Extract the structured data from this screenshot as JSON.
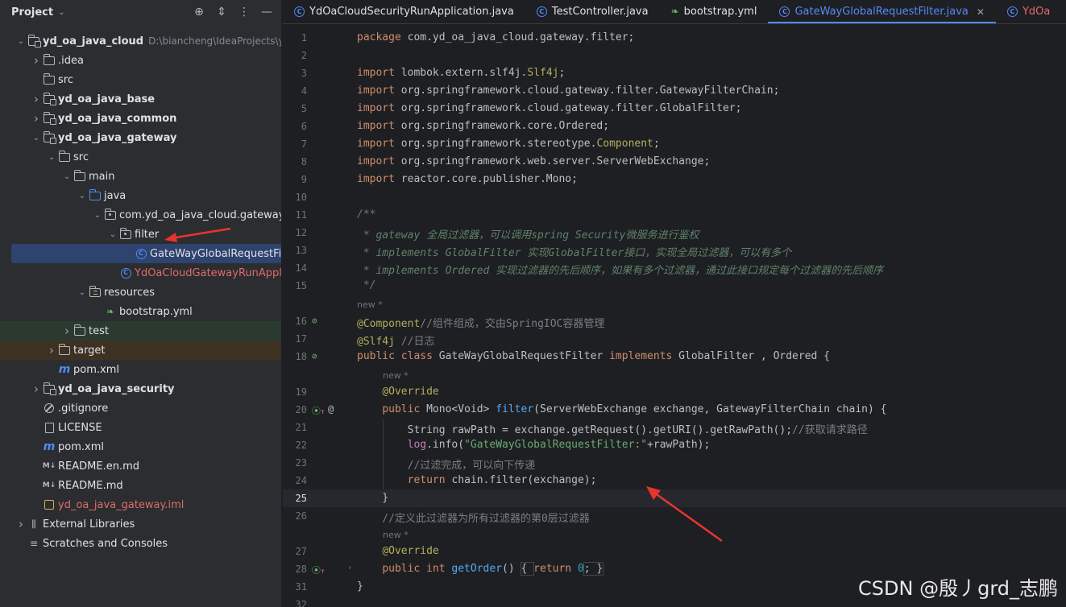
{
  "project_panel": {
    "title": "Project",
    "tree": [
      {
        "label": "yd_oa_java_cloud",
        "path": "D:\\biancheng\\IdeaProjects\\yd",
        "indent": 0,
        "arrow": "down",
        "icon": "module-folder",
        "bold": true
      },
      {
        "label": ".idea",
        "indent": 1,
        "arrow": "right",
        "icon": "folder"
      },
      {
        "label": "src",
        "indent": 1,
        "arrow": "",
        "icon": "folder"
      },
      {
        "label": "yd_oa_java_base",
        "indent": 1,
        "arrow": "right",
        "icon": "module-folder",
        "bold": true
      },
      {
        "label": "yd_oa_java_common",
        "indent": 1,
        "arrow": "right",
        "icon": "module-folder",
        "bold": true
      },
      {
        "label": "yd_oa_java_gateway",
        "indent": 1,
        "arrow": "down",
        "icon": "module-folder",
        "bold": true
      },
      {
        "label": "src",
        "indent": 2,
        "arrow": "down",
        "icon": "folder"
      },
      {
        "label": "main",
        "indent": 3,
        "arrow": "down",
        "icon": "folder"
      },
      {
        "label": "java",
        "indent": 4,
        "arrow": "down",
        "icon": "blue-folder"
      },
      {
        "label": "com.yd_oa_java_cloud.gateway",
        "indent": 5,
        "arrow": "down",
        "icon": "package-folder"
      },
      {
        "label": "filter",
        "indent": 6,
        "arrow": "down",
        "icon": "package-folder"
      },
      {
        "label": "GateWayGlobalRequestFilter",
        "indent": 7,
        "arrow": "",
        "icon": "class",
        "selected": true
      },
      {
        "label": "YdOaCloudGatewayRunApplication",
        "indent": 6,
        "arrow": "",
        "icon": "class",
        "red": true
      },
      {
        "label": "resources",
        "indent": 4,
        "arrow": "down",
        "icon": "resources-folder"
      },
      {
        "label": "bootstrap.yml",
        "indent": 5,
        "arrow": "",
        "icon": "leaf"
      },
      {
        "label": "test",
        "indent": 3,
        "arrow": "right",
        "icon": "folder",
        "bg": "green"
      },
      {
        "label": "target",
        "indent": 2,
        "arrow": "right",
        "icon": "folder",
        "bg": "orange"
      },
      {
        "label": "pom.xml",
        "indent": 2,
        "arrow": "",
        "icon": "maven"
      },
      {
        "label": "yd_oa_java_security",
        "indent": 1,
        "arrow": "right",
        "icon": "module-folder",
        "bold": true
      },
      {
        "label": ".gitignore",
        "indent": 1,
        "arrow": "",
        "icon": "ignore"
      },
      {
        "label": "LICENSE",
        "indent": 1,
        "arrow": "",
        "icon": "file"
      },
      {
        "label": "pom.xml",
        "indent": 1,
        "arrow": "",
        "icon": "maven"
      },
      {
        "label": "README.en.md",
        "indent": 1,
        "arrow": "",
        "icon": "markdown"
      },
      {
        "label": "README.md",
        "indent": 1,
        "arrow": "",
        "icon": "markdown"
      },
      {
        "label": "yd_oa_java_gateway.iml",
        "indent": 1,
        "arrow": "",
        "icon": "iml",
        "red": true
      },
      {
        "label": "External Libraries",
        "indent": 0,
        "arrow": "right",
        "icon": "library"
      },
      {
        "label": "Scratches and Consoles",
        "indent": 0,
        "arrow": "",
        "icon": "scratches"
      }
    ]
  },
  "tabs": [
    {
      "label": "YdOaCloudSecurityRunApplication.java",
      "icon": "class",
      "active": false
    },
    {
      "label": "TestController.java",
      "icon": "class",
      "active": false
    },
    {
      "label": "bootstrap.yml",
      "icon": "leaf",
      "active": false
    },
    {
      "label": "GateWayGlobalRequestFilter.java",
      "icon": "class",
      "active": true,
      "close": "✕"
    },
    {
      "label": "YdOa",
      "icon": "class",
      "active": false,
      "red": true
    }
  ],
  "editor": {
    "lines": [
      {
        "n": "1",
        "seg": [
          [
            "kw",
            "package "
          ],
          [
            "",
            "com.yd_oa_java_cloud.gateway.filter;"
          ]
        ]
      },
      {
        "n": "2",
        "seg": []
      },
      {
        "n": "3",
        "seg": [
          [
            "kw",
            "import "
          ],
          [
            "",
            "lombok.extern.slf4j."
          ],
          [
            "ann",
            "Slf4j"
          ],
          [
            "",
            ";"
          ]
        ]
      },
      {
        "n": "4",
        "seg": [
          [
            "kw",
            "import "
          ],
          [
            "",
            "org.springframework.cloud.gateway.filter.GatewayFilterChain;"
          ]
        ]
      },
      {
        "n": "5",
        "seg": [
          [
            "kw",
            "import "
          ],
          [
            "",
            "org.springframework.cloud.gateway.filter.GlobalFilter;"
          ]
        ]
      },
      {
        "n": "6",
        "seg": [
          [
            "kw",
            "import "
          ],
          [
            "",
            "org.springframework.core.Ordered;"
          ]
        ]
      },
      {
        "n": "7",
        "seg": [
          [
            "kw",
            "import "
          ],
          [
            "",
            "org.springframework.stereotype."
          ],
          [
            "ann",
            "Component"
          ],
          [
            "",
            ";"
          ]
        ]
      },
      {
        "n": "8",
        "seg": [
          [
            "kw",
            "import "
          ],
          [
            "",
            "org.springframework.web.server.ServerWebExchange;"
          ]
        ]
      },
      {
        "n": "9",
        "seg": [
          [
            "kw",
            "import "
          ],
          [
            "",
            "reactor.core.publisher.Mono;"
          ]
        ]
      },
      {
        "n": "10",
        "seg": []
      },
      {
        "n": "11",
        "seg": [
          [
            "doc",
            "/**"
          ]
        ]
      },
      {
        "n": "12",
        "seg": [
          [
            "doc",
            " * gateway 全局过滤器，可以调用spring Security微服务进行鉴权"
          ]
        ]
      },
      {
        "n": "13",
        "seg": [
          [
            "doc",
            " * implements GlobalFilter 实现GlobalFilter接口，实现全局过滤器，可以有多个"
          ]
        ]
      },
      {
        "n": "14",
        "seg": [
          [
            "doc",
            " * implements Ordered 实现过滤器的先后顺序，如果有多个过滤器，通过此接口规定每个过滤器的先后顺序"
          ]
        ]
      },
      {
        "n": "15",
        "seg": [
          [
            "doc",
            " */"
          ]
        ]
      },
      {
        "hint": "new *",
        "indent": 0
      },
      {
        "n": "16",
        "gutter": "bean",
        "seg": [
          [
            "ann",
            "@Component"
          ],
          [
            "cmt",
            "//组件组成，交由SpringIOC容器管理"
          ]
        ]
      },
      {
        "n": "17",
        "seg": [
          [
            "ann",
            "@Slf4j"
          ],
          [
            "cmt",
            " //日志"
          ]
        ]
      },
      {
        "n": "18",
        "gutter": "bean",
        "seg": [
          [
            "kw",
            "public class "
          ],
          [
            "",
            "GateWayGlobalRequestFilter "
          ],
          [
            "kw",
            "implements "
          ],
          [
            "",
            "GlobalFilter , Ordered {"
          ]
        ]
      },
      {
        "hint": "new *",
        "indent": 1
      },
      {
        "n": "19",
        "seg": [
          [
            "",
            "    "
          ],
          [
            "ann",
            "@Override"
          ]
        ]
      },
      {
        "n": "20",
        "gutter": "override",
        "gutter2": "@",
        "seg": [
          [
            "",
            "    "
          ],
          [
            "kw",
            "public "
          ],
          [
            "",
            "Mono<Void> "
          ],
          [
            "fn",
            "filter"
          ],
          [
            "",
            "(ServerWebExchange exchange, GatewayFilterChain chain) {"
          ]
        ]
      },
      {
        "n": "21",
        "guide": true,
        "seg": [
          [
            "",
            "        String rawPath = exchange.getRequest().getURI().getRawPath();"
          ],
          [
            "cmt",
            "//获取请求路径"
          ]
        ]
      },
      {
        "n": "22",
        "guide": true,
        "seg": [
          [
            "",
            "        "
          ],
          [
            "fld",
            "log"
          ],
          [
            "",
            ".info("
          ],
          [
            "str",
            "\"GateWayGlobalRequestFilter:\""
          ],
          [
            "",
            "+rawPath);"
          ]
        ]
      },
      {
        "n": "23",
        "guide": true,
        "seg": [
          [
            "cmt",
            "        //过滤完成，可以向下传递"
          ]
        ]
      },
      {
        "n": "24",
        "guide": true,
        "seg": [
          [
            "",
            "        "
          ],
          [
            "kw",
            "return "
          ],
          [
            "",
            "chain.filter(exchange);"
          ]
        ]
      },
      {
        "n": "25",
        "current": true,
        "seg": [
          [
            "",
            "    }"
          ]
        ]
      },
      {
        "n": "26",
        "seg": [
          [
            "cmt",
            "    //定义此过滤器为所有过滤器的第0层过滤器"
          ]
        ]
      },
      {
        "hint": "new *",
        "indent": 1
      },
      {
        "n": "27",
        "seg": [
          [
            "",
            "    "
          ],
          [
            "ann",
            "@Override"
          ]
        ]
      },
      {
        "n": "28",
        "gutter": "override",
        "fold": "›",
        "seg": [
          [
            "",
            "    "
          ],
          [
            "kw",
            "public int "
          ],
          [
            "fn",
            "getOrder"
          ],
          [
            "",
            "() "
          ],
          [
            "box",
            "{ "
          ],
          [
            "kw",
            "return "
          ],
          [
            "num",
            "0"
          ],
          [
            "box",
            "; }"
          ]
        ]
      },
      {
        "n": "31",
        "seg": [
          [
            "",
            "}"
          ]
        ]
      },
      {
        "n": "32",
        "seg": []
      }
    ]
  },
  "watermark": "CSDN @殷丿grd_志鹏",
  "colors": {
    "accent": "#548af7",
    "annotation_arrow": "#e8342f"
  }
}
